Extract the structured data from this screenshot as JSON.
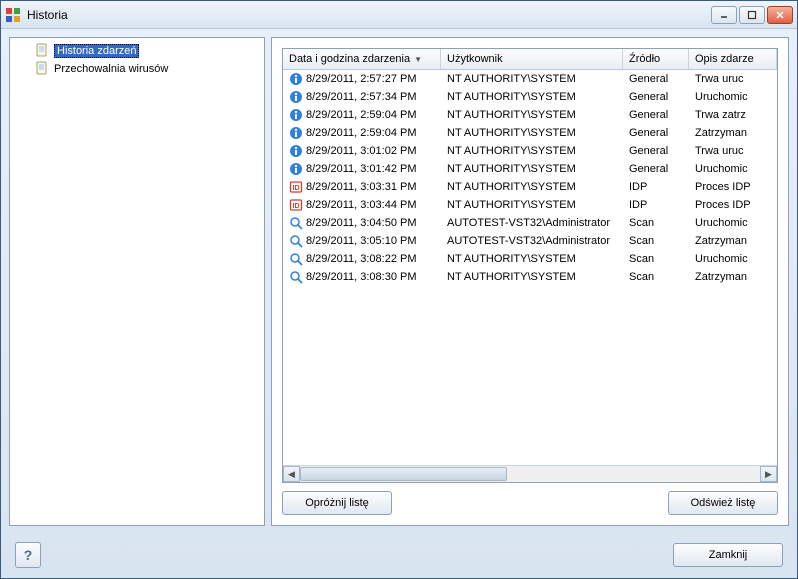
{
  "window": {
    "title": "Historia"
  },
  "tree": {
    "items": [
      {
        "label": "Historia zdarzeń",
        "selected": true
      },
      {
        "label": "Przechowalnia wirusów",
        "selected": false
      }
    ]
  },
  "columns": {
    "date": "Data i godzina zdarzenia",
    "user": "Użytkownik",
    "source": "Źródło",
    "desc": "Opis zdarze"
  },
  "rows": [
    {
      "icon": "info",
      "date": "8/29/2011, 2:57:27 PM",
      "user": "NT AUTHORITY\\SYSTEM",
      "source": "General",
      "desc": "Trwa uruc"
    },
    {
      "icon": "info",
      "date": "8/29/2011, 2:57:34 PM",
      "user": "NT AUTHORITY\\SYSTEM",
      "source": "General",
      "desc": "Uruchomic"
    },
    {
      "icon": "info",
      "date": "8/29/2011, 2:59:04 PM",
      "user": "NT AUTHORITY\\SYSTEM",
      "source": "General",
      "desc": "Trwa zatrz"
    },
    {
      "icon": "info",
      "date": "8/29/2011, 2:59:04 PM",
      "user": "NT AUTHORITY\\SYSTEM",
      "source": "General",
      "desc": "Zatrzyman"
    },
    {
      "icon": "info",
      "date": "8/29/2011, 3:01:02 PM",
      "user": "NT AUTHORITY\\SYSTEM",
      "source": "General",
      "desc": "Trwa uruc"
    },
    {
      "icon": "info",
      "date": "8/29/2011, 3:01:42 PM",
      "user": "NT AUTHORITY\\SYSTEM",
      "source": "General",
      "desc": "Uruchomic"
    },
    {
      "icon": "idp",
      "date": "8/29/2011, 3:03:31 PM",
      "user": "NT AUTHORITY\\SYSTEM",
      "source": "IDP",
      "desc": "Proces IDP"
    },
    {
      "icon": "idp",
      "date": "8/29/2011, 3:03:44 PM",
      "user": "NT AUTHORITY\\SYSTEM",
      "source": "IDP",
      "desc": "Proces IDP"
    },
    {
      "icon": "scan",
      "date": "8/29/2011, 3:04:50 PM",
      "user": "AUTOTEST-VST32\\Administrator",
      "source": "Scan",
      "desc": "Uruchomic"
    },
    {
      "icon": "scan",
      "date": "8/29/2011, 3:05:10 PM",
      "user": "AUTOTEST-VST32\\Administrator",
      "source": "Scan",
      "desc": "Zatrzyman"
    },
    {
      "icon": "scan",
      "date": "8/29/2011, 3:08:22 PM",
      "user": "NT AUTHORITY\\SYSTEM",
      "source": "Scan",
      "desc": "Uruchomic"
    },
    {
      "icon": "scan",
      "date": "8/29/2011, 3:08:30 PM",
      "user": "NT AUTHORITY\\SYSTEM",
      "source": "Scan",
      "desc": "Zatrzyman"
    }
  ],
  "buttons": {
    "empty_list": "Opróżnij listę",
    "refresh_list": "Odśwież listę",
    "close": "Zamknij",
    "help": "?"
  }
}
